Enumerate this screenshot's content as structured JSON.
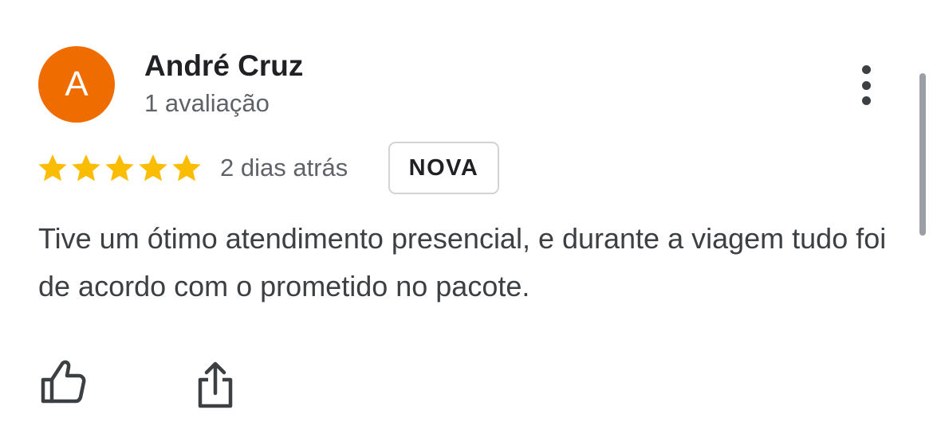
{
  "review": {
    "reviewer_name": "André Cruz",
    "avatar_letter": "A",
    "review_count": "1 avaliação",
    "rating": 5,
    "max_rating": 5,
    "date": "2 dias atrás",
    "badge": "NOVA",
    "text": "Tive um ótimo atendimento presencial, e durante a viagem tudo foi de acordo com o prometido no pacote."
  },
  "icons": {
    "menu": "more-vertical-icon",
    "star": "star-icon",
    "like": "thumbs-up-icon",
    "share": "share-icon"
  },
  "colors": {
    "avatar": "#ef6c00",
    "star": "#fbbc04",
    "name": "#202124",
    "secondary_text": "#5f6368",
    "body_text": "#3c4043"
  }
}
